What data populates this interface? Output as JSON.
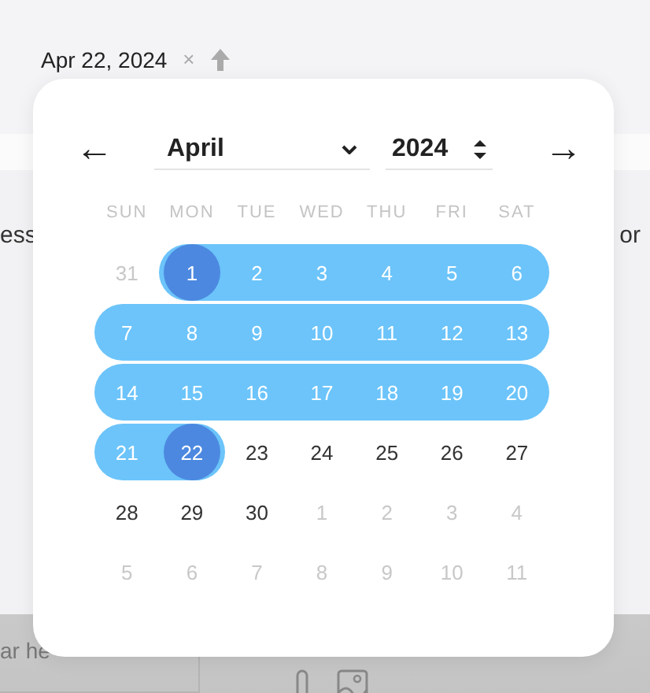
{
  "date_field": {
    "value": "Apr 22, 2024",
    "clear": "×"
  },
  "background": {
    "left_text": "ess",
    "right_text": "or",
    "input_text": "ar he"
  },
  "calendar": {
    "prev": "←",
    "next": "→",
    "month": "April",
    "year": "2024",
    "weekdays": [
      "SUN",
      "MON",
      "TUE",
      "WED",
      "THU",
      "FRI",
      "SAT"
    ],
    "weeks": [
      [
        {
          "label": "31",
          "muted": true,
          "in_range": false,
          "selected": false
        },
        {
          "label": "1",
          "muted": false,
          "in_range": true,
          "selected": true
        },
        {
          "label": "2",
          "muted": false,
          "in_range": true,
          "selected": false
        },
        {
          "label": "3",
          "muted": false,
          "in_range": true,
          "selected": false
        },
        {
          "label": "4",
          "muted": false,
          "in_range": true,
          "selected": false
        },
        {
          "label": "5",
          "muted": false,
          "in_range": true,
          "selected": false
        },
        {
          "label": "6",
          "muted": false,
          "in_range": true,
          "selected": false
        }
      ],
      [
        {
          "label": "7",
          "muted": false,
          "in_range": true,
          "selected": false
        },
        {
          "label": "8",
          "muted": false,
          "in_range": true,
          "selected": false
        },
        {
          "label": "9",
          "muted": false,
          "in_range": true,
          "selected": false
        },
        {
          "label": "10",
          "muted": false,
          "in_range": true,
          "selected": false
        },
        {
          "label": "11",
          "muted": false,
          "in_range": true,
          "selected": false
        },
        {
          "label": "12",
          "muted": false,
          "in_range": true,
          "selected": false
        },
        {
          "label": "13",
          "muted": false,
          "in_range": true,
          "selected": false
        }
      ],
      [
        {
          "label": "14",
          "muted": false,
          "in_range": true,
          "selected": false
        },
        {
          "label": "15",
          "muted": false,
          "in_range": true,
          "selected": false
        },
        {
          "label": "16",
          "muted": false,
          "in_range": true,
          "selected": false
        },
        {
          "label": "17",
          "muted": false,
          "in_range": true,
          "selected": false
        },
        {
          "label": "18",
          "muted": false,
          "in_range": true,
          "selected": false
        },
        {
          "label": "19",
          "muted": false,
          "in_range": true,
          "selected": false
        },
        {
          "label": "20",
          "muted": false,
          "in_range": true,
          "selected": false
        }
      ],
      [
        {
          "label": "21",
          "muted": false,
          "in_range": true,
          "selected": false
        },
        {
          "label": "22",
          "muted": false,
          "in_range": true,
          "selected": true
        },
        {
          "label": "23",
          "muted": false,
          "in_range": false,
          "selected": false
        },
        {
          "label": "24",
          "muted": false,
          "in_range": false,
          "selected": false
        },
        {
          "label": "25",
          "muted": false,
          "in_range": false,
          "selected": false
        },
        {
          "label": "26",
          "muted": false,
          "in_range": false,
          "selected": false
        },
        {
          "label": "27",
          "muted": false,
          "in_range": false,
          "selected": false
        }
      ],
      [
        {
          "label": "28",
          "muted": false,
          "in_range": false,
          "selected": false
        },
        {
          "label": "29",
          "muted": false,
          "in_range": false,
          "selected": false
        },
        {
          "label": "30",
          "muted": false,
          "in_range": false,
          "selected": false
        },
        {
          "label": "1",
          "muted": true,
          "in_range": false,
          "selected": false
        },
        {
          "label": "2",
          "muted": true,
          "in_range": false,
          "selected": false
        },
        {
          "label": "3",
          "muted": true,
          "in_range": false,
          "selected": false
        },
        {
          "label": "4",
          "muted": true,
          "in_range": false,
          "selected": false
        }
      ],
      [
        {
          "label": "5",
          "muted": true,
          "in_range": false,
          "selected": false
        },
        {
          "label": "6",
          "muted": true,
          "in_range": false,
          "selected": false
        },
        {
          "label": "7",
          "muted": true,
          "in_range": false,
          "selected": false
        },
        {
          "label": "8",
          "muted": true,
          "in_range": false,
          "selected": false
        },
        {
          "label": "9",
          "muted": true,
          "in_range": false,
          "selected": false
        },
        {
          "label": "10",
          "muted": true,
          "in_range": false,
          "selected": false
        },
        {
          "label": "11",
          "muted": true,
          "in_range": false,
          "selected": false
        }
      ]
    ]
  }
}
